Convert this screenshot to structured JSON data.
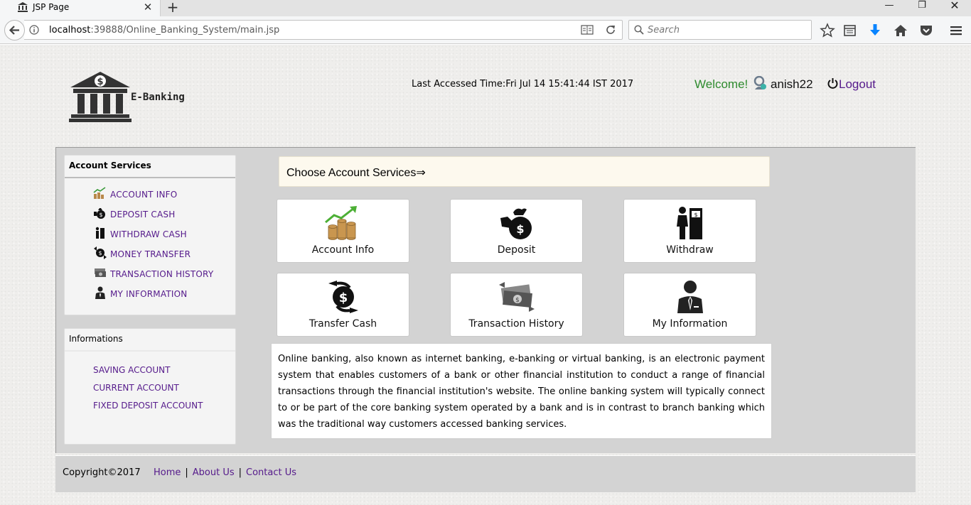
{
  "browser": {
    "tab_title": "JSP Page",
    "url_host": "localhost",
    "url_rest": ":39888/Online_Banking_System/main.jsp",
    "search_placeholder": "Search"
  },
  "header": {
    "brand": "E-Banking",
    "last_accessed": "Last Accessed Time:Fri Jul 14 15:41:44 IST 2017",
    "welcome": "Welcome!",
    "username": "anish22",
    "logout": "Logout"
  },
  "sidebar": {
    "services_title": "Account Services",
    "services": [
      {
        "label": "ACCOUNT INFO",
        "icon": "coins-growth-icon"
      },
      {
        "label": "DEPOSIT CASH",
        "icon": "money-bag-icon"
      },
      {
        "label": "WITHDRAW CASH",
        "icon": "atm-person-icon"
      },
      {
        "label": "MONEY TRANSFER",
        "icon": "transfer-icon"
      },
      {
        "label": "TRANSACTION HISTORY",
        "icon": "banknotes-icon"
      },
      {
        "label": "MY INFORMATION",
        "icon": "businessman-icon"
      }
    ],
    "info_title": "Informations",
    "info_links": [
      "SAVING ACCOUNT",
      "CURRENT ACCOUNT",
      "FIXED DEPOSIT ACCOUNT"
    ]
  },
  "main": {
    "choose": "Choose Account Services⇒",
    "cards": [
      {
        "label": "Account Info",
        "icon": "coins-growth-icon"
      },
      {
        "label": "Deposit",
        "icon": "money-bag-icon"
      },
      {
        "label": "Withdraw",
        "icon": "atm-person-icon"
      },
      {
        "label": "Transfer Cash",
        "icon": "transfer-icon"
      },
      {
        "label": "Transaction History",
        "icon": "banknotes-icon"
      },
      {
        "label": "My Information",
        "icon": "businessman-icon"
      }
    ],
    "description": "Online banking, also known as internet banking, e-banking or virtual banking, is an electronic payment system that enables customers of a bank or other financial institution to conduct a range of financial transactions through the financial institution's website. The online banking system will typically connect to or be part of the core banking system operated by a bank and is in contrast to branch banking which was the traditional way customers accessed banking services."
  },
  "footer": {
    "copyright": "Copyright©2017",
    "links": [
      "Home",
      "About Us",
      "Contact Us"
    ]
  },
  "colors": {
    "link": "#551a8b",
    "welcome": "#2e8b2e",
    "content_bg": "#d3d3d3",
    "choose_bg": "#fdf9ee"
  }
}
